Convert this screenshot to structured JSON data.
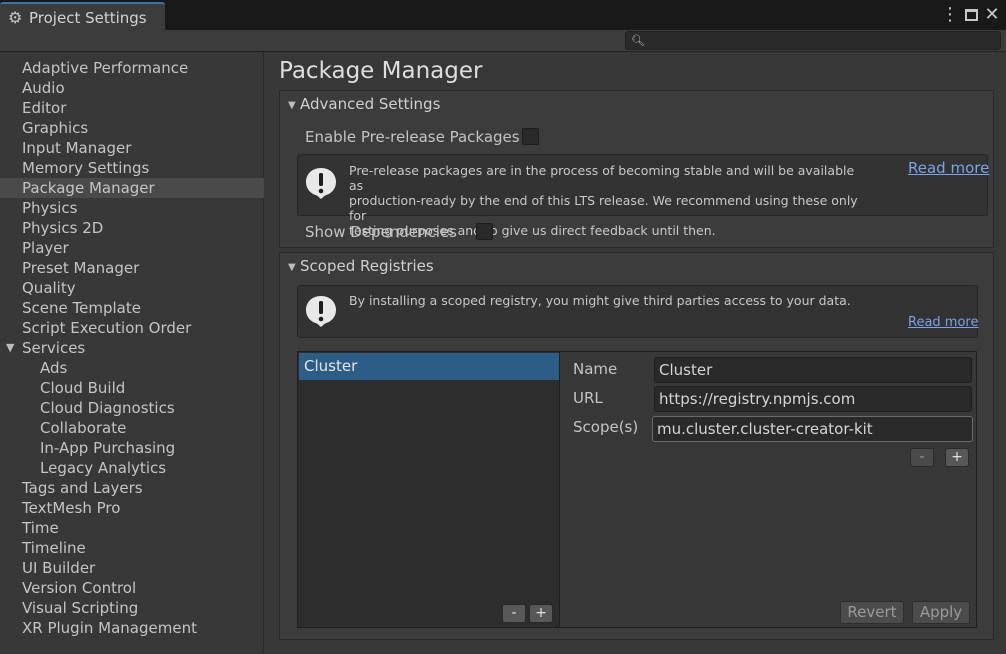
{
  "window": {
    "tab_title": "Project Settings",
    "tab_icon": "gear-icon",
    "menu_icon": "⋮",
    "close_icon": "✕"
  },
  "search": {
    "value": "",
    "placeholder": ""
  },
  "sidebar": {
    "selected": "Package Manager",
    "items": [
      {
        "label": "Adaptive Performance",
        "level": 0
      },
      {
        "label": "Audio",
        "level": 0
      },
      {
        "label": "Editor",
        "level": 0
      },
      {
        "label": "Graphics",
        "level": 0
      },
      {
        "label": "Input Manager",
        "level": 0
      },
      {
        "label": "Memory Settings",
        "level": 0
      },
      {
        "label": "Package Manager",
        "level": 0
      },
      {
        "label": "Physics",
        "level": 0
      },
      {
        "label": "Physics 2D",
        "level": 0
      },
      {
        "label": "Player",
        "level": 0
      },
      {
        "label": "Preset Manager",
        "level": 0
      },
      {
        "label": "Quality",
        "level": 0
      },
      {
        "label": "Scene Template",
        "level": 0
      },
      {
        "label": "Script Execution Order",
        "level": 0
      },
      {
        "label": "Services",
        "level": 0,
        "expanded": true
      },
      {
        "label": "Ads",
        "level": 1
      },
      {
        "label": "Cloud Build",
        "level": 1
      },
      {
        "label": "Cloud Diagnostics",
        "level": 1
      },
      {
        "label": "Collaborate",
        "level": 1
      },
      {
        "label": "In-App Purchasing",
        "level": 1
      },
      {
        "label": "Legacy Analytics",
        "level": 1
      },
      {
        "label": "Tags and Layers",
        "level": 0
      },
      {
        "label": "TextMesh Pro",
        "level": 0
      },
      {
        "label": "Time",
        "level": 0
      },
      {
        "label": "Timeline",
        "level": 0
      },
      {
        "label": "UI Builder",
        "level": 0
      },
      {
        "label": "Version Control",
        "level": 0
      },
      {
        "label": "Visual Scripting",
        "level": 0
      },
      {
        "label": "XR Plugin Management",
        "level": 0
      }
    ]
  },
  "main": {
    "title": "Package Manager",
    "advanced": {
      "title": "Advanced Settings",
      "prerelease_label": "Enable Pre-release Packages",
      "prerelease_checked": false,
      "help_line1": "Pre-release packages are in the process of becoming stable and will be available as",
      "help_line2": "production-ready by the end of this LTS release. We recommend using these only for",
      "help_line3": "testing purposes and to give us direct feedback until then.",
      "read_more": "Read more",
      "deps_label": "Show Dependencies",
      "deps_checked": false
    },
    "scoped": {
      "title": "Scoped Registries",
      "help_text": "By installing a scoped registry, you might give third parties access to your data.",
      "read_more": "Read more",
      "registries": [
        "Cluster"
      ],
      "selected_registry": "Cluster",
      "name_label": "Name",
      "name_value": "Cluster",
      "url_label": "URL",
      "url_value": "https://registry.npmjs.com",
      "scopes_label": "Scope(s)",
      "scopes_value": "mu.cluster.cluster-creator-kit",
      "minus": "-",
      "plus": "+",
      "revert_label": "Revert",
      "apply_label": "Apply"
    }
  }
}
